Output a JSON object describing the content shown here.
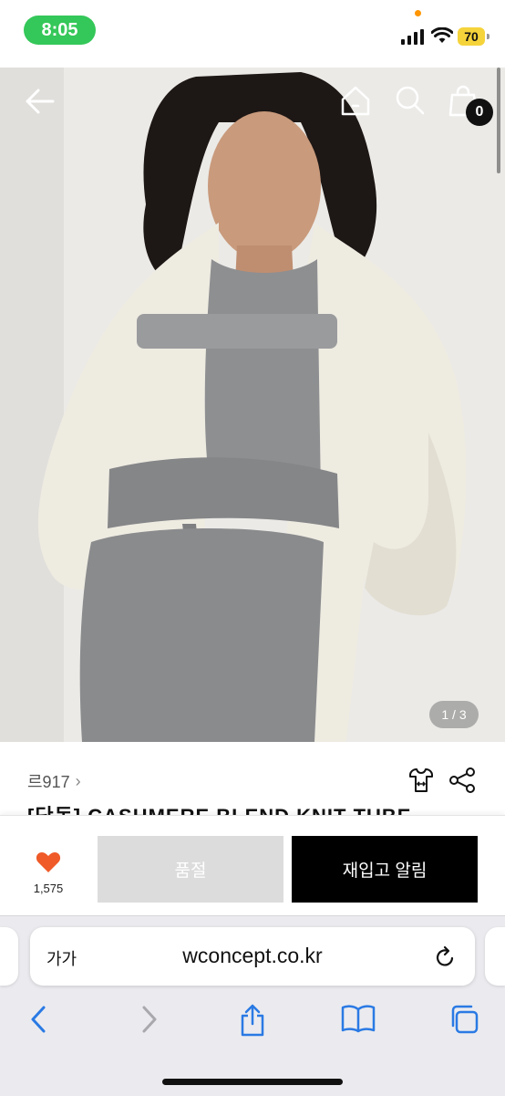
{
  "status": {
    "time": "8:05",
    "battery": "70",
    "time_color": "#34c759",
    "battery_color": "#f5d33a"
  },
  "product": {
    "image_counter": "1 / 3",
    "cart_count": "0",
    "brand": "르917",
    "title": "[단독] CASHMERE BLEND KNIT TUBE",
    "likes": "1,575",
    "sold_out_label": "품절",
    "notify_label": "재입고 알림",
    "accent_heart": "#ef5a28"
  },
  "browser": {
    "text_size": "가가",
    "url": "wconcept.co.kr"
  },
  "icons": [
    "back-arrow-icon",
    "home-icon",
    "search-icon",
    "shopping-bag-icon",
    "hanger-icon",
    "share-icon",
    "heart-icon",
    "reload-icon",
    "chevron-left-icon",
    "chevron-right-icon",
    "share-box-icon",
    "book-icon",
    "tabs-icon"
  ]
}
